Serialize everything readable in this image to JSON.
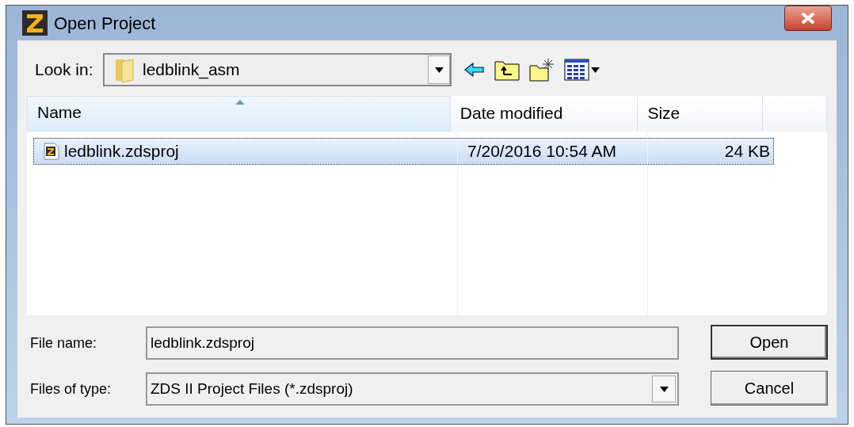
{
  "window": {
    "title": "Open Project"
  },
  "look_in": {
    "label": "Look in:",
    "value": "ledblink_asm"
  },
  "file_list": {
    "columns": [
      {
        "label": "Name",
        "sorted": true
      },
      {
        "label": "Date modified",
        "sorted": false
      },
      {
        "label": "Size",
        "sorted": false
      }
    ],
    "rows": [
      {
        "name": "ledblink.zdsproj",
        "date_modified": "7/20/2016 10:54 AM",
        "size": "24 KB",
        "selected": true
      }
    ]
  },
  "file_name": {
    "label": "File name:",
    "value": "ledblink.zdsproj"
  },
  "file_type": {
    "label": "Files of type:",
    "value": "ZDS II Project Files (*.zdsproj)"
  },
  "buttons": [
    {
      "label": "Open",
      "default": true
    },
    {
      "label": "Cancel",
      "default": false
    }
  ]
}
